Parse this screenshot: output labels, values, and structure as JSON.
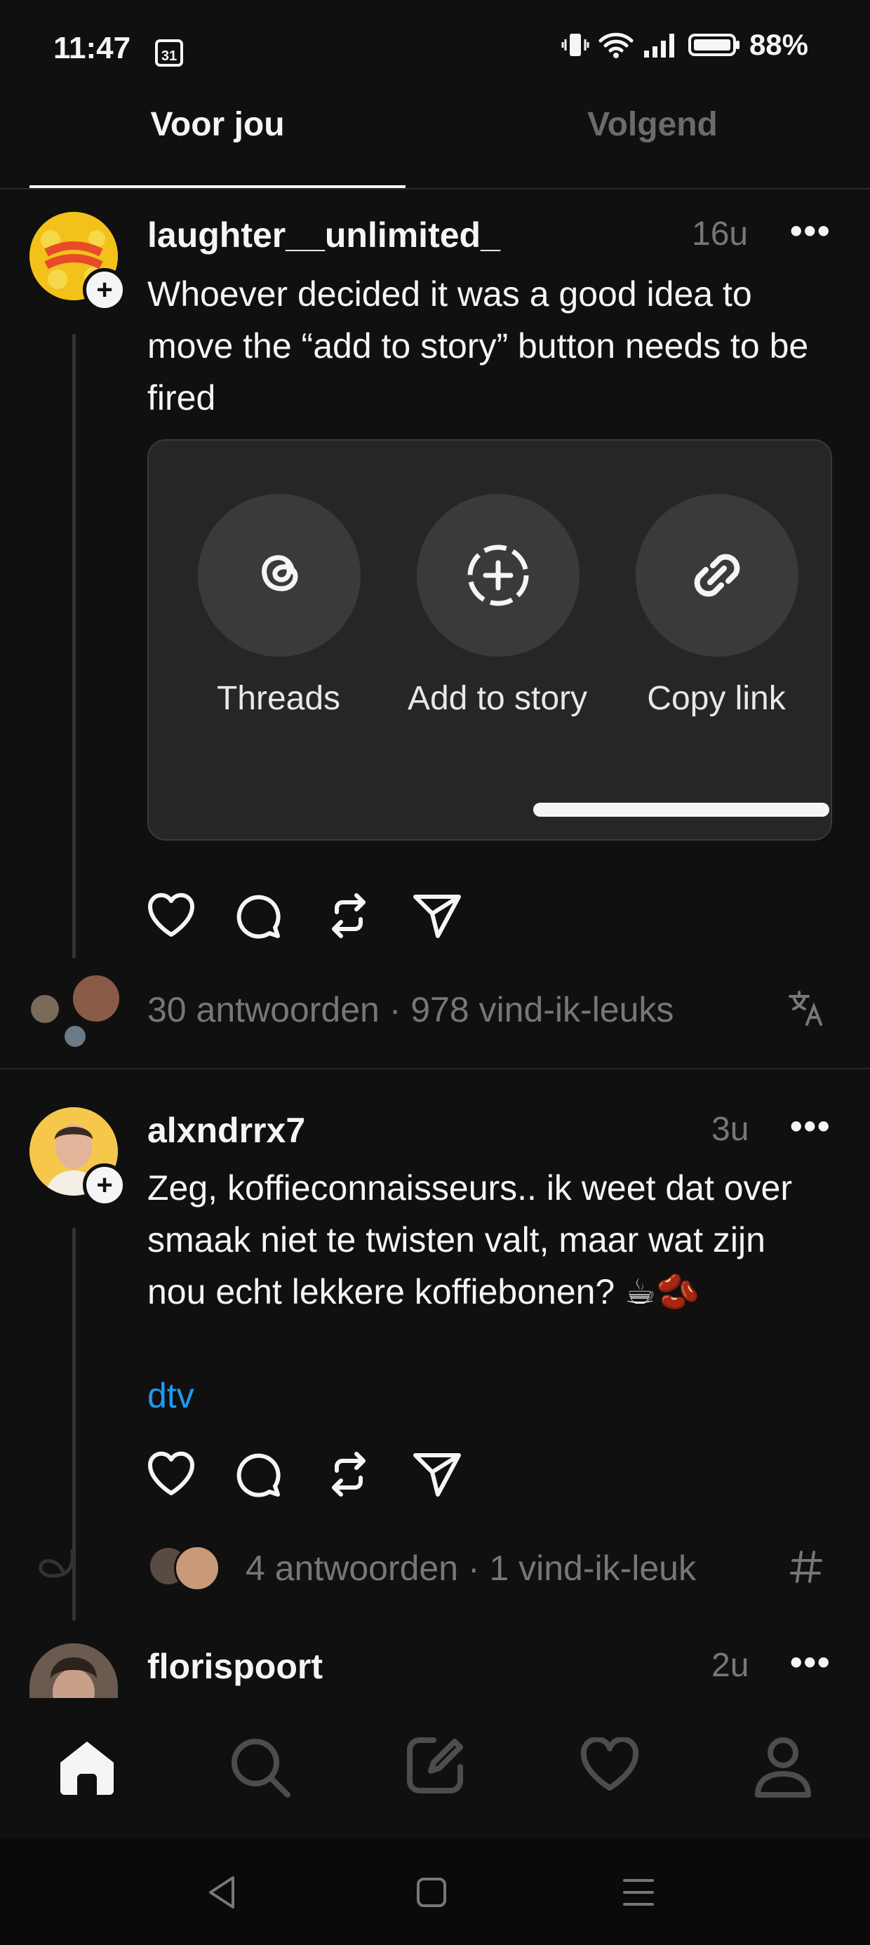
{
  "status_bar": {
    "time": "11:47",
    "calendar_day": "31",
    "battery": "88%"
  },
  "tabs": [
    {
      "label": "Voor jou",
      "active": true
    },
    {
      "label": "Volgend",
      "active": false
    }
  ],
  "posts": [
    {
      "username": "laughter__unlimited_",
      "time": "16u",
      "text_lines": [
        "Whoever decided it was a good idea to",
        "move the “add to story” button needs to be",
        "fired"
      ],
      "share_options": [
        {
          "label": "Threads",
          "icon": "threads-icon"
        },
        {
          "label": "Add to story",
          "icon": "add-to-story-icon"
        },
        {
          "label": "Copy link",
          "icon": "link-icon"
        }
      ],
      "meta": "30 antwoorden · 978 vind-ik-leuks",
      "avatar_color": "#f2c21a"
    },
    {
      "username": "alxndrrx7",
      "time": "3u",
      "text_lines": [
        "Zeg, koffieconnaisseurs.. ik weet dat over",
        "smaak niet te twisten valt, maar wat zijn",
        "nou echt lekkere koffiebonen? ☕🫘"
      ],
      "link": "dtv",
      "meta": "4 antwoorden · 1 vind-ik-leuk",
      "avatar_color": "#f5c84c"
    },
    {
      "username": "florispoort",
      "time": "2u"
    }
  ],
  "more_label": "•••",
  "nav": [
    "home-icon",
    "search-icon",
    "compose-icon",
    "activity-heart-icon",
    "profile-icon"
  ],
  "colors": {
    "background": "#101010",
    "text": "#f3f5f7",
    "muted": "#777777",
    "link": "#1d9bf0"
  }
}
